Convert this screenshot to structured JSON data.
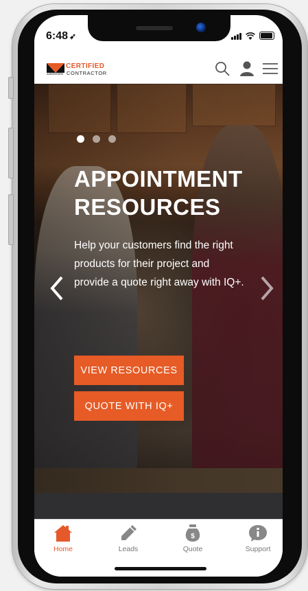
{
  "status_bar": {
    "time": "6:48",
    "location_icon": "location-arrow-icon"
  },
  "header": {
    "logo_top": "CERTIFIED",
    "logo_bottom": "CONTRACTOR",
    "logo_brand": "ANDERSEN",
    "icons": [
      "search-icon",
      "user-icon",
      "hamburger-menu-icon"
    ]
  },
  "hero": {
    "title_line1": "APPOINTMENT",
    "title_line2": "RESOURCES",
    "body": "Help your customers find the right products for their project and provide a quote right away with IQ+.",
    "slide_count": 3,
    "active_slide": 1,
    "buttons": {
      "primary": "VIEW RESOURCES",
      "secondary": "QUOTE WITH IQ+"
    }
  },
  "tabbar": {
    "items": [
      {
        "label": "Home",
        "icon": "home-icon",
        "active": true
      },
      {
        "label": "Leads",
        "icon": "pencil-icon",
        "active": false
      },
      {
        "label": "Quote",
        "icon": "money-bag-icon",
        "active": false
      },
      {
        "label": "Support",
        "icon": "info-bubble-icon",
        "active": false
      }
    ]
  },
  "colors": {
    "accent": "#e65b26",
    "active_tab": "#e5592a",
    "inactive_tab": "#777777"
  }
}
